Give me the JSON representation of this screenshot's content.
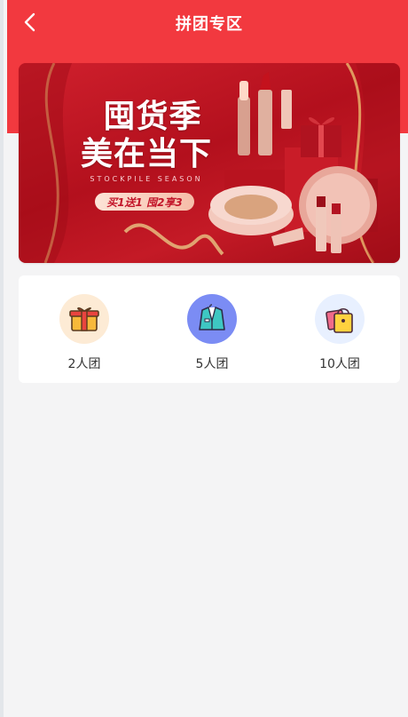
{
  "header": {
    "title": "拼团专区"
  },
  "banner": {
    "line1": "囤货季",
    "line2": "美在当下",
    "subtitle": "STOCKPILE SEASON",
    "promo": "买1送1 囤2享3"
  },
  "categories": [
    {
      "label": "2人团",
      "icon": "gift-box-icon",
      "bg": "#fdebd5"
    },
    {
      "label": "5人团",
      "icon": "suit-jacket-icon",
      "bg": "#7b8cf4"
    },
    {
      "label": "10人团",
      "icon": "shopping-bag-icon",
      "bg": "#e8f0ff"
    }
  ],
  "colors": {
    "header_red": "#f2393f",
    "page_bg": "#f4f4f5"
  }
}
